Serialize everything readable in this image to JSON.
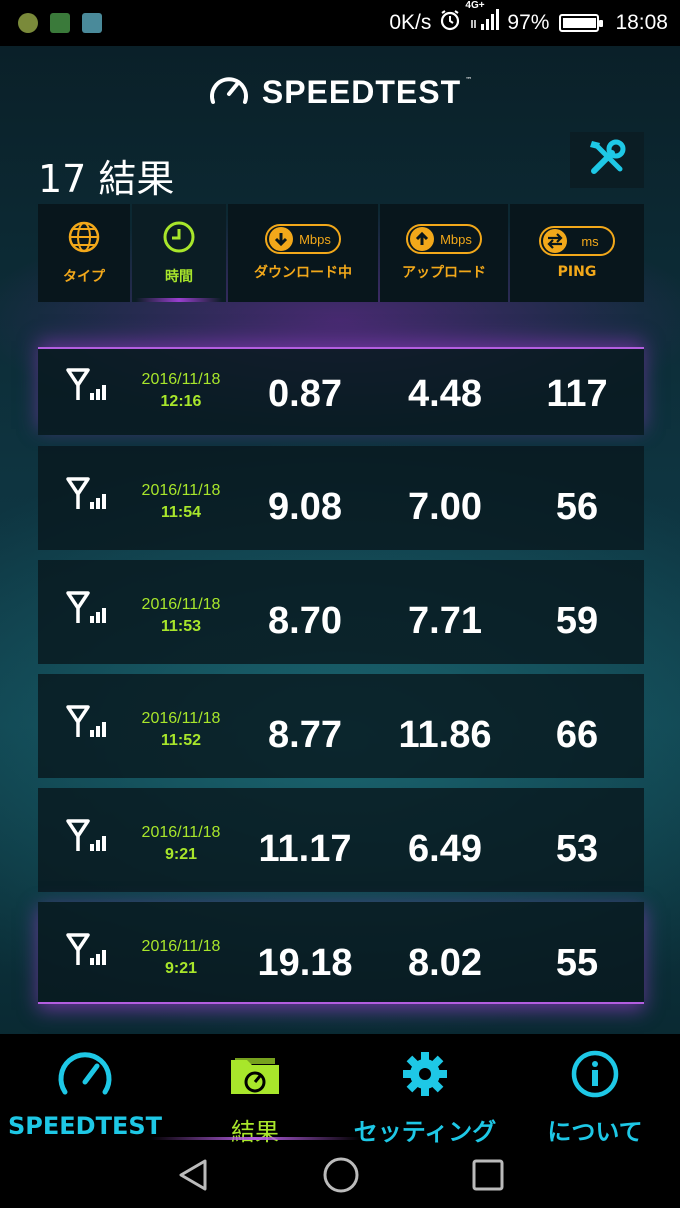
{
  "status_bar": {
    "left_icons": [
      "mix-app-icon",
      "robot-app-icon",
      "gallery-app-icon"
    ],
    "net_speed": "0K/s",
    "network_type": "4G+",
    "battery": "97%",
    "battery_level": 0.97,
    "time": "18:08"
  },
  "header": {
    "logo_text": "SPEEDTEST",
    "trademark": "™"
  },
  "results": {
    "title": "17 結果"
  },
  "columns": [
    {
      "label": "タイプ",
      "icon": "globe-icon"
    },
    {
      "label": "時間",
      "icon": "clock-icon",
      "active": true
    },
    {
      "label": "ダウンロード中",
      "icon": "download-icon",
      "unit": "Mbps"
    },
    {
      "label": "アップロード",
      "icon": "upload-icon",
      "unit": "Mbps"
    },
    {
      "label": "PING",
      "icon": "ping-icon",
      "unit": "ms"
    }
  ],
  "rows": [
    {
      "date": "2016/11/18",
      "time": "12:16",
      "download": "0.87",
      "upload": "4.48",
      "ping": "117"
    },
    {
      "date": "2016/11/18",
      "time": "11:54",
      "download": "9.08",
      "upload": "7.00",
      "ping": "56"
    },
    {
      "date": "2016/11/18",
      "time": "11:53",
      "download": "8.70",
      "upload": "7.71",
      "ping": "59"
    },
    {
      "date": "2016/11/18",
      "time": "11:52",
      "download": "8.77",
      "upload": "11.86",
      "ping": "66"
    },
    {
      "date": "2016/11/18",
      "time": "9:21",
      "download": "11.17",
      "upload": "6.49",
      "ping": "53"
    },
    {
      "date": "2016/11/18",
      "time": "9:21",
      "download": "19.18",
      "upload": "8.02",
      "ping": "55"
    }
  ],
  "bottom_nav": [
    {
      "label": "SPEEDTEST",
      "icon": "speedometer-icon"
    },
    {
      "label": "結果",
      "icon": "results-folder-icon",
      "active": true
    },
    {
      "label": "セッティング",
      "icon": "gear-icon"
    },
    {
      "label": "について",
      "icon": "info-icon"
    }
  ],
  "colors": {
    "accent_orange": "#f2a81a",
    "accent_green": "#a8e62b",
    "accent_cyan": "#1ec8e6",
    "accent_purple": "#b35ee0"
  }
}
